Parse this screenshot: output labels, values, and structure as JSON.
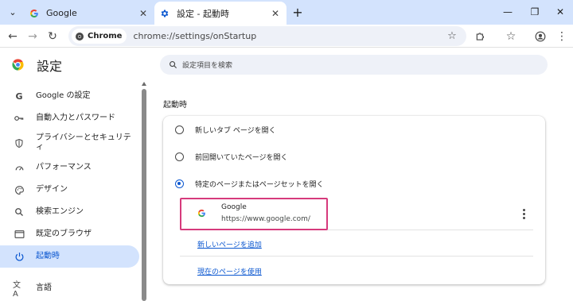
{
  "browser": {
    "tabs": [
      {
        "title": "Google",
        "active": false
      },
      {
        "title": "設定 - 起動時",
        "active": true
      }
    ],
    "chip_label": "Chrome",
    "url": "chrome://settings/onStartup"
  },
  "settings": {
    "title": "設定",
    "search_placeholder": "設定項目を検索",
    "nav": [
      {
        "label": "Google の設定",
        "icon": "google-g-icon"
      },
      {
        "label": "自動入力とパスワード",
        "icon": "key-icon"
      },
      {
        "label": "プライバシーとセキュリティ",
        "icon": "shield-icon"
      },
      {
        "label": "パフォーマンス",
        "icon": "speedometer-icon"
      },
      {
        "label": "デザイン",
        "icon": "palette-icon"
      },
      {
        "label": "検索エンジン",
        "icon": "search-icon"
      },
      {
        "label": "既定のブラウザ",
        "icon": "browser-window-icon"
      },
      {
        "label": "起動時",
        "icon": "power-icon",
        "selected": true
      },
      {
        "label": "言語",
        "icon": "translate-icon"
      }
    ],
    "section_title": "起動時",
    "options": [
      {
        "label": "新しいタブ ページを開く",
        "checked": false
      },
      {
        "label": "前回開いていたページを開く",
        "checked": false
      },
      {
        "label": "特定のページまたはページセットを開く",
        "checked": true
      }
    ],
    "startup_page": {
      "name": "Google",
      "url": "https://www.google.com/"
    },
    "add_page_link": "新しいページを追加",
    "use_current_link": "現在のページを使用"
  },
  "colors": {
    "accent": "#0b57d0",
    "highlight": "#d63a7c",
    "tabstrip": "#d3e3fd"
  }
}
